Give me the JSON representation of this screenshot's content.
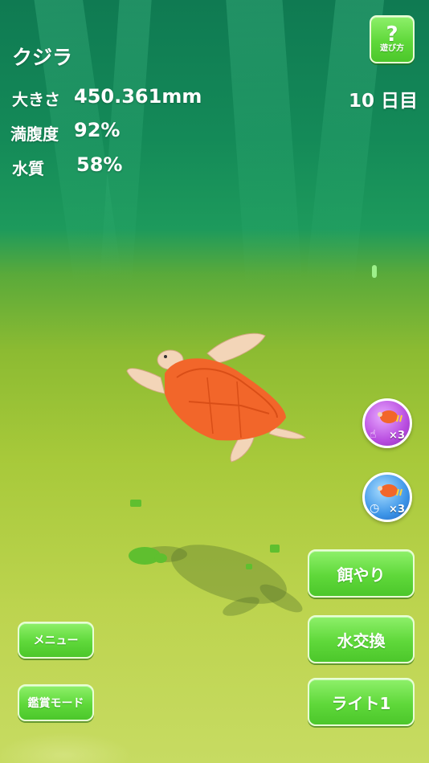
{
  "creature": {
    "name": "クジラ"
  },
  "stats": {
    "size_label": "大きさ",
    "size_value": "450.361mm",
    "fullness_label": "満腹度",
    "fullness_value": "92%",
    "water_label": "水質",
    "water_value": "58%"
  },
  "day": {
    "value": "10 日目"
  },
  "help": {
    "icon": "?",
    "label": "遊び方"
  },
  "boosts": [
    {
      "icon": "tap-turtle-icon",
      "multiplier": "×3"
    },
    {
      "icon": "timer-turtle-icon",
      "multiplier": "×3"
    }
  ],
  "actions": {
    "feed": "餌やり",
    "water_change": "水交換",
    "light": "ライト1"
  },
  "left_buttons": {
    "menu": "メニュー",
    "viewing_mode": "鑑賞モード"
  },
  "colors": {
    "button_green": "#5fd83a",
    "turtle_shell": "#f2662a",
    "water_top": "#0f7a52",
    "water_bottom": "#c7db62"
  }
}
